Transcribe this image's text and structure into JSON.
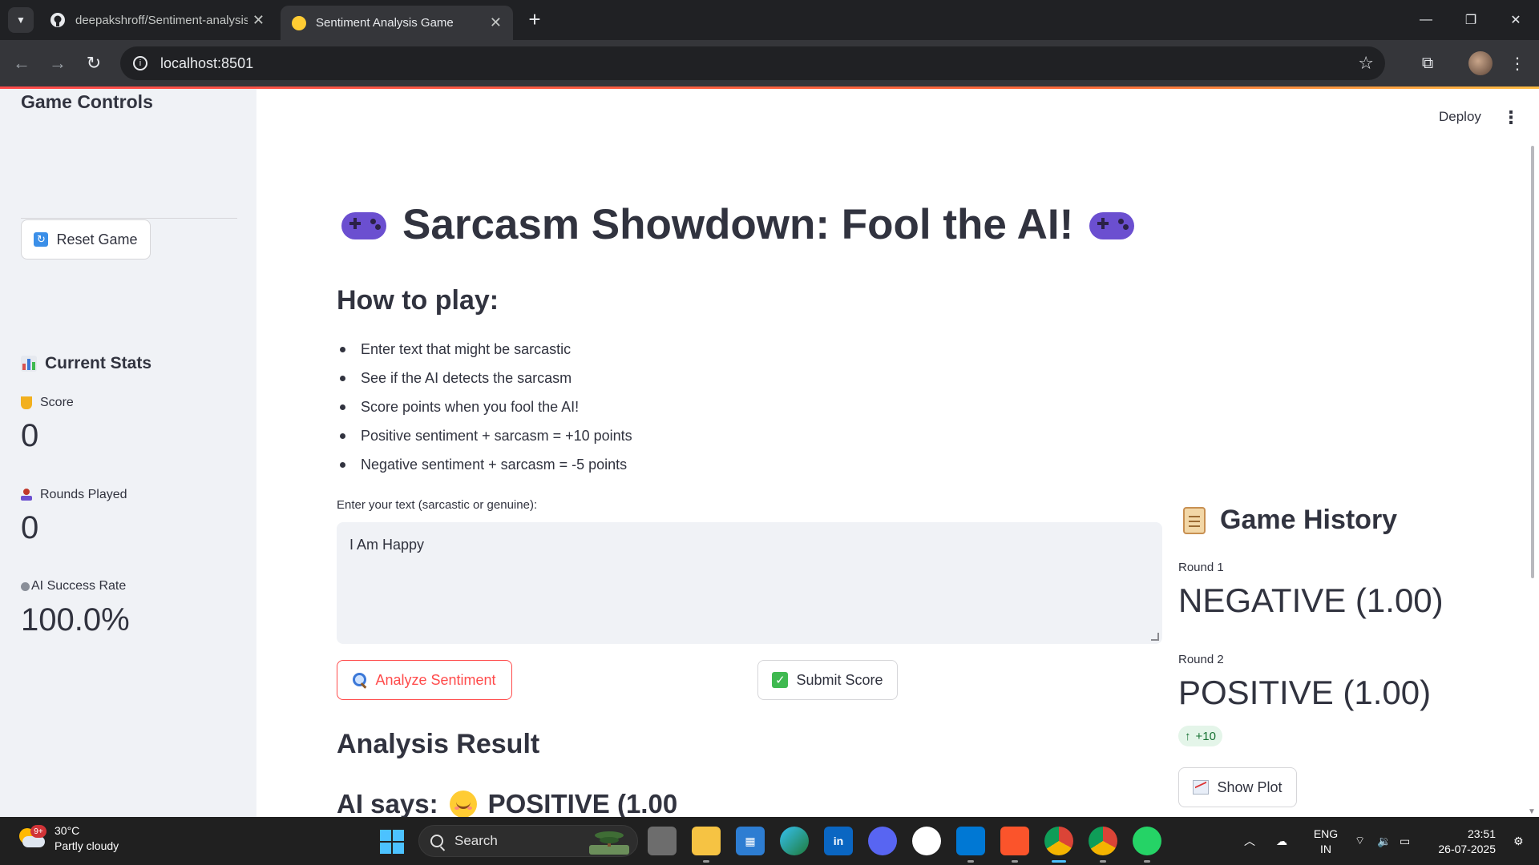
{
  "browser": {
    "tabs": [
      {
        "title": "deepakshroff/Sentiment-analysis",
        "active": false
      },
      {
        "title": "Sentiment Analysis Game",
        "active": true
      }
    ],
    "url": "localhost:8501"
  },
  "app": {
    "deploy_label": "Deploy",
    "sidebar": {
      "heading": "Game Controls",
      "reset_label": "Reset Game",
      "stats_heading": "Current Stats",
      "metrics": [
        {
          "icon": "trophy-icon",
          "label": "Score",
          "value": "0"
        },
        {
          "icon": "joystick-icon",
          "label": "Rounds Played",
          "value": "0"
        },
        {
          "icon": "robot-icon",
          "label": "AI Success Rate",
          "value": "100.0%"
        }
      ]
    },
    "main": {
      "title": "Sarcasm Showdown: Fool the AI!",
      "how_to_heading": "How to play:",
      "rules": [
        "Enter text that might be sarcastic",
        "See if the AI detects the sarcasm",
        "Score points when you fool the AI!",
        "Positive sentiment + sarcasm = +10 points",
        "Negative sentiment + sarcasm = -5 points"
      ],
      "input_label": "Enter your text (sarcastic or genuine):",
      "input_value": "I Am Happy",
      "analyze_label": "Analyze Sentiment",
      "submit_label": "Submit Score",
      "result_heading": "Analysis Result",
      "ai_says_prefix": "AI says:",
      "ai_says_result": "POSITIVE (1.00"
    },
    "history": {
      "heading": "Game History",
      "rounds": [
        {
          "label": "Round 1",
          "value": "NEGATIVE (1.00)"
        },
        {
          "label": "Round 2",
          "value": "POSITIVE (1.00)",
          "delta": "+10"
        }
      ],
      "show_plot_label": "Show Plot"
    }
  },
  "taskbar": {
    "weather": {
      "temp": "30°C",
      "desc": "Partly cloudy",
      "badge": "9+"
    },
    "search_label": "Search",
    "lang": {
      "line1": "ENG",
      "line2": "IN"
    },
    "time": "23:51",
    "date": "26-07-2025"
  },
  "colors": {
    "accent": "#ff4b4b",
    "sidebar_bg": "#f0f2f6",
    "text": "#31333f",
    "delta_green": "#177233"
  }
}
